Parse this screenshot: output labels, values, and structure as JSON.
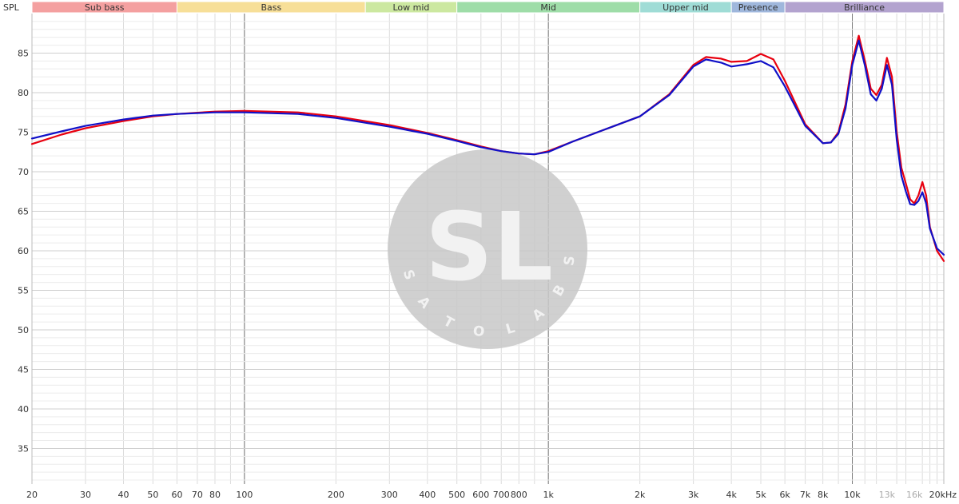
{
  "chart_data": {
    "type": "line",
    "ylabel": "SPL",
    "x_scale": "log",
    "xlim": [
      20,
      20000
    ],
    "ylim": [
      30.5,
      90
    ],
    "grid": true,
    "watermark": {
      "text": "SL",
      "ring_text": "SATO LABS"
    },
    "bands": [
      {
        "name": "Sub bass",
        "from": 20,
        "to": 60,
        "color": "#f4a0a0"
      },
      {
        "name": "Bass",
        "from": 60,
        "to": 250,
        "color": "#f7df98"
      },
      {
        "name": "Low mid",
        "from": 250,
        "to": 500,
        "color": "#cce8a0"
      },
      {
        "name": "Mid",
        "from": 500,
        "to": 2000,
        "color": "#9edda8"
      },
      {
        "name": "Upper mid",
        "from": 2000,
        "to": 4000,
        "color": "#9fdcd6"
      },
      {
        "name": "Presence",
        "from": 4000,
        "to": 6000,
        "color": "#9fb7dc"
      },
      {
        "name": "Brilliance",
        "from": 6000,
        "to": 20000,
        "color": "#b3a3cf"
      }
    ],
    "x_ticks": [
      {
        "v": 20,
        "label": "20"
      },
      {
        "v": 30,
        "label": "30"
      },
      {
        "v": 40,
        "label": "40"
      },
      {
        "v": 50,
        "label": "50"
      },
      {
        "v": 60,
        "label": "60"
      },
      {
        "v": 70,
        "label": "70"
      },
      {
        "v": 80,
        "label": "80"
      },
      {
        "v": 100,
        "label": "100"
      },
      {
        "v": 200,
        "label": "200"
      },
      {
        "v": 300,
        "label": "300"
      },
      {
        "v": 400,
        "label": "400"
      },
      {
        "v": 500,
        "label": "500"
      },
      {
        "v": 600,
        "label": "600"
      },
      {
        "v": 700,
        "label": "700"
      },
      {
        "v": 800,
        "label": "800"
      },
      {
        "v": 1000,
        "label": "1k"
      },
      {
        "v": 2000,
        "label": "2k"
      },
      {
        "v": 3000,
        "label": "3k"
      },
      {
        "v": 4000,
        "label": "4k"
      },
      {
        "v": 5000,
        "label": "5k"
      },
      {
        "v": 6000,
        "label": "6k"
      },
      {
        "v": 7000,
        "label": "7k"
      },
      {
        "v": 8000,
        "label": "8k"
      },
      {
        "v": 10000,
        "label": "10k"
      },
      {
        "v": 13000,
        "label": "13k",
        "muted": true
      },
      {
        "v": 16000,
        "label": "16k",
        "muted": true
      },
      {
        "v": 20000,
        "label": "20kHz"
      }
    ],
    "y_ticks": [
      35,
      40,
      45,
      50,
      55,
      60,
      65,
      70,
      75,
      80,
      85
    ],
    "series": [
      {
        "color": "#e8000f",
        "x": [
          20,
          25,
          30,
          40,
          50,
          60,
          80,
          100,
          150,
          200,
          300,
          400,
          500,
          600,
          700,
          800,
          900,
          1000,
          1200,
          1500,
          2000,
          2500,
          3000,
          3300,
          3700,
          4000,
          4500,
          5000,
          5500,
          6000,
          7000,
          8000,
          8500,
          9000,
          9500,
          10000,
          10500,
          11000,
          11500,
          12000,
          12500,
          13000,
          13500,
          14000,
          14500,
          15000,
          15500,
          16000,
          16500,
          17000,
          17500,
          18000,
          19000,
          20000
        ],
        "y": [
          73.5,
          74.7,
          75.5,
          76.4,
          77.0,
          77.3,
          77.6,
          77.7,
          77.5,
          77.0,
          75.9,
          74.9,
          74.0,
          73.2,
          72.6,
          72.3,
          72.2,
          72.6,
          73.8,
          75.2,
          77.0,
          79.8,
          83.5,
          84.5,
          84.3,
          83.9,
          84.0,
          84.9,
          84.2,
          81.5,
          76.0,
          73.6,
          73.7,
          75.0,
          78.5,
          84.0,
          87.2,
          84.0,
          80.5,
          79.7,
          81.0,
          84.4,
          82.0,
          75.0,
          70.5,
          68.5,
          66.5,
          66.0,
          67.0,
          68.7,
          67.0,
          63.0,
          60.0,
          58.7
        ]
      },
      {
        "color": "#1010c8",
        "x": [
          20,
          25,
          30,
          40,
          50,
          60,
          80,
          100,
          150,
          200,
          300,
          400,
          500,
          600,
          700,
          800,
          900,
          1000,
          1200,
          1500,
          2000,
          2500,
          3000,
          3300,
          3700,
          4000,
          4500,
          5000,
          5500,
          6000,
          7000,
          8000,
          8500,
          9000,
          9500,
          10000,
          10500,
          11000,
          11500,
          12000,
          12500,
          13000,
          13500,
          14000,
          14500,
          15000,
          15500,
          16000,
          16500,
          17000,
          17500,
          18000,
          19000,
          20000
        ],
        "y": [
          74.2,
          75.1,
          75.8,
          76.6,
          77.1,
          77.3,
          77.5,
          77.5,
          77.3,
          76.8,
          75.7,
          74.8,
          73.9,
          73.1,
          72.6,
          72.3,
          72.2,
          72.5,
          73.8,
          75.2,
          77.0,
          79.7,
          83.3,
          84.2,
          83.8,
          83.3,
          83.6,
          84.0,
          83.2,
          80.8,
          75.8,
          73.6,
          73.7,
          74.8,
          78.0,
          83.5,
          86.6,
          83.4,
          79.8,
          79.0,
          80.5,
          83.5,
          81.0,
          74.0,
          69.5,
          67.5,
          65.9,
          65.8,
          66.3,
          67.4,
          66.0,
          62.8,
          60.3,
          59.5
        ]
      }
    ]
  }
}
